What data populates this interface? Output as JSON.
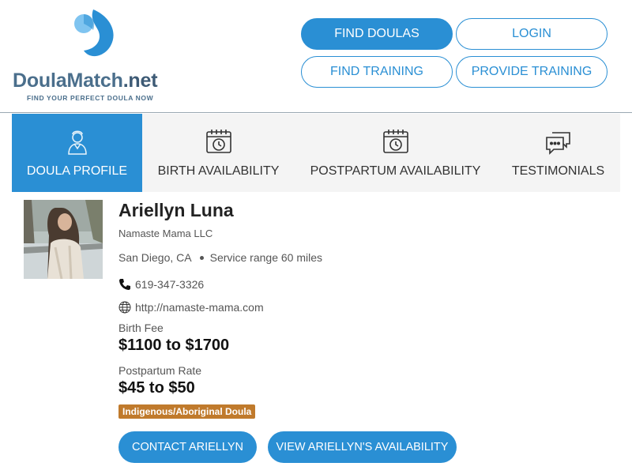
{
  "logo": {
    "name_main": "DoulaMatch",
    "name_suffix": ".net",
    "tagline": "FIND YOUR PERFECT DOULA NOW",
    "colors": {
      "drop": "#2a8fd4",
      "drop_light": "#7fc4f0",
      "text": "#4b6f8c"
    }
  },
  "nav": {
    "find_doulas": "FIND DOULAS",
    "login": "LOGIN",
    "find_training": "FIND TRAINING",
    "provide_training": "PROVIDE TRAINING"
  },
  "tabs": [
    {
      "label": "DOULA PROFILE",
      "icon": "person-icon",
      "active": true
    },
    {
      "label": "BIRTH AVAILABILITY",
      "icon": "calendar-clock-icon",
      "active": false
    },
    {
      "label": "POSTPARTUM AVAILABILITY",
      "icon": "calendar-clock-icon",
      "active": false
    },
    {
      "label": "TESTIMONIALS",
      "icon": "chat-bubbles-icon",
      "active": false
    }
  ],
  "profile": {
    "name": "Ariellyn Luna",
    "company": "Namaste Mama LLC",
    "city": "San Diego, CA",
    "service_range": "Service range 60 miles",
    "phone": "619-347-3326",
    "website": "http://namaste-mama.com",
    "birth_fee_label": "Birth Fee",
    "birth_fee": "$1100 to $1700",
    "postpartum_label": "Postpartum Rate",
    "postpartum_rate": "$45 to $50",
    "badge": "Indigenous/Aboriginal Doula",
    "badge_color": "#c07a2c"
  },
  "actions": {
    "contact": "CONTACT ARIELLYN",
    "availability": "VIEW ARIELLYN'S AVAILABILITY"
  },
  "colors": {
    "accent": "#2a8fd4",
    "tab_bg": "#f4f4f4"
  }
}
